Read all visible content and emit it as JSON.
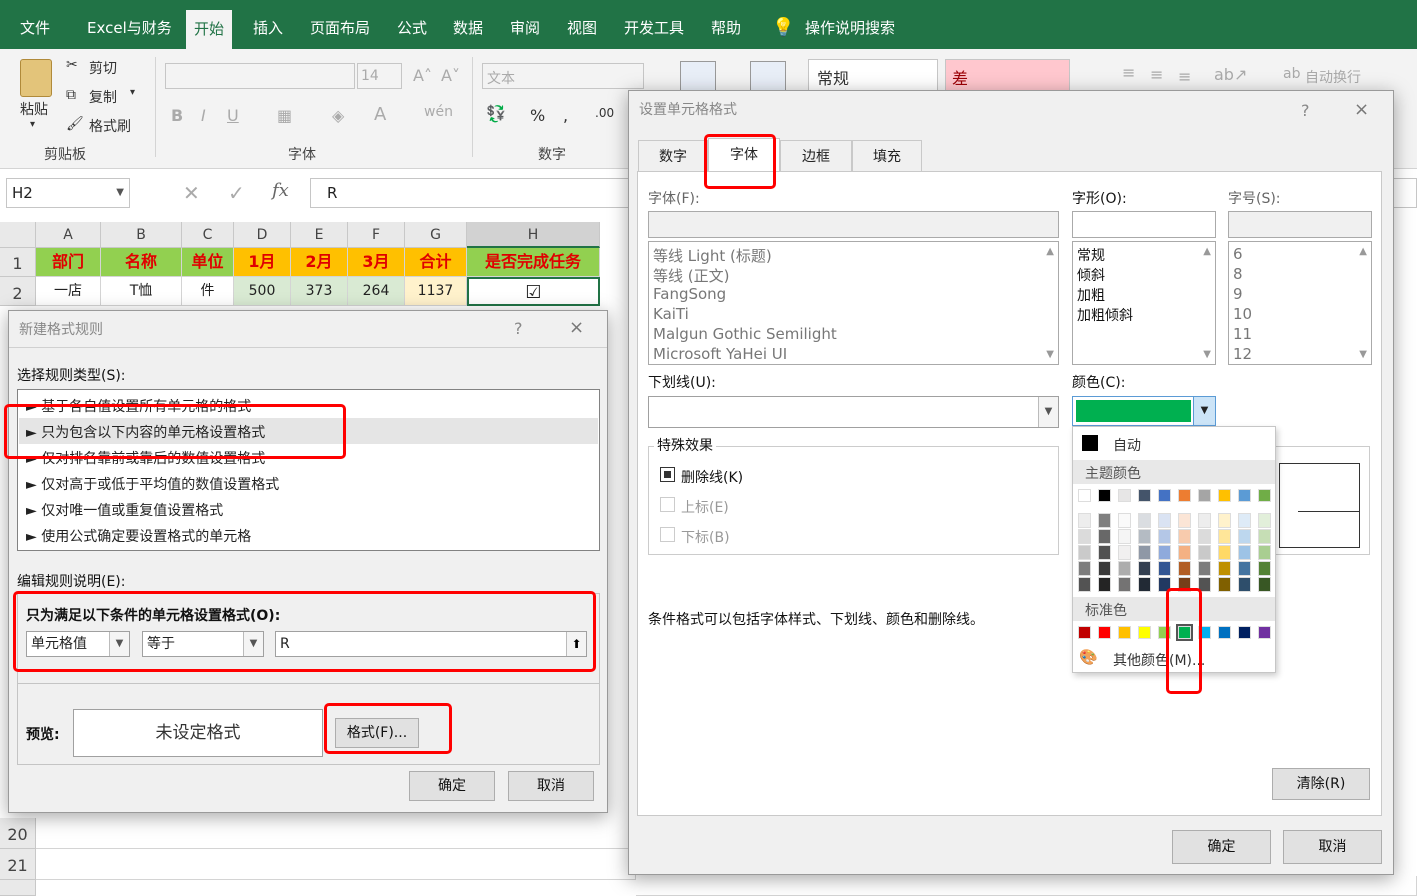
{
  "menu": {
    "items": [
      "文件",
      "Excel与财务",
      "开始",
      "插入",
      "页面布局",
      "公式",
      "数据",
      "审阅",
      "视图",
      "开发工具",
      "帮助"
    ],
    "active": "开始",
    "search": "操作说明搜索"
  },
  "ribbon": {
    "paste": "粘贴",
    "cut": "剪切",
    "copy": "复制",
    "format_painter": "格式刷",
    "clipboard_group": "剪贴板",
    "font_size": "14",
    "font_group": "字体",
    "number_format": "文本",
    "number_group": "数字",
    "style_normal": "常规",
    "style_bad": "差",
    "wrap_text": "自动换行"
  },
  "formula_bar": {
    "name_box": "H2",
    "fx": "fx",
    "value": "R"
  },
  "grid": {
    "columns": [
      "A",
      "B",
      "C",
      "D",
      "E",
      "F",
      "G",
      "H"
    ],
    "header_row": [
      "部门",
      "名称",
      "单位",
      "1月",
      "2月",
      "3月",
      "合计",
      "是否完成任务"
    ],
    "row2": [
      "一店",
      "T恤",
      "件",
      "500",
      "373",
      "264",
      "1137",
      "☑"
    ],
    "row_numbers": [
      "1",
      "2",
      "20",
      "21"
    ]
  },
  "new_rule_dialog": {
    "title": "新建格式规则",
    "help": "?",
    "close": "×",
    "select_type_label": "选择规则类型(S):",
    "rule_types": [
      "► 基于各自值设置所有单元格的格式",
      "► 只为包含以下内容的单元格设置格式",
      "► 仅对排名靠前或靠后的数值设置格式",
      "► 仅对高于或低于平均值的数值设置格式",
      "► 仅对唯一值或重复值设置格式",
      "► 使用公式确定要设置格式的单元格"
    ],
    "edit_label": "编辑规则说明(E):",
    "condition_title": "只为满足以下条件的单元格设置格式(O):",
    "condition_field": "单元格值",
    "condition_operator": "等于",
    "condition_value": "R",
    "preview_label": "预览:",
    "preview_text": "未设定格式",
    "format_button": "格式(F)...",
    "ok": "确定",
    "cancel": "取消"
  },
  "format_cells_dialog": {
    "title": "设置单元格格式",
    "help": "?",
    "close": "×",
    "tabs": [
      "数字",
      "字体",
      "边框",
      "填充"
    ],
    "active_tab": "字体",
    "font_label": "字体(F):",
    "fonts": [
      "等线 Light (标题)",
      "等线 (正文)",
      "FangSong",
      "KaiTi",
      "Malgun Gothic Semilight",
      "Microsoft YaHei UI"
    ],
    "style_label": "字形(O):",
    "styles": [
      "常规",
      "倾斜",
      "加粗",
      "加粗倾斜"
    ],
    "size_label": "字号(S):",
    "sizes": [
      "6",
      "8",
      "9",
      "10",
      "11",
      "12"
    ],
    "underline_label": "下划线(U):",
    "color_label": "颜色(C):",
    "selected_color": "#00b050",
    "effects_label": "特殊效果",
    "strikethrough": "删除线(K)",
    "superscript": "上标(E)",
    "subscript": "下标(B)",
    "note": "条件格式可以包括字体样式、下划线、颜色和删除线。",
    "clear": "清除(R)",
    "ok": "确定",
    "cancel": "取消"
  },
  "color_picker": {
    "auto": "自动",
    "theme_label": "主题颜色",
    "standard_label": "标准色",
    "more": "其他颜色(M)...",
    "theme_top": [
      "#ffffff",
      "#000000",
      "#e7e6e6",
      "#44546a",
      "#4472c4",
      "#ed7d31",
      "#a5a5a5",
      "#ffc000",
      "#5b9bd5",
      "#70ad47"
    ],
    "standard": [
      "#c00000",
      "#ff0000",
      "#ffc000",
      "#ffff00",
      "#92d050",
      "#00b050",
      "#00b0f0",
      "#0070c0",
      "#002060",
      "#7030a0"
    ]
  }
}
